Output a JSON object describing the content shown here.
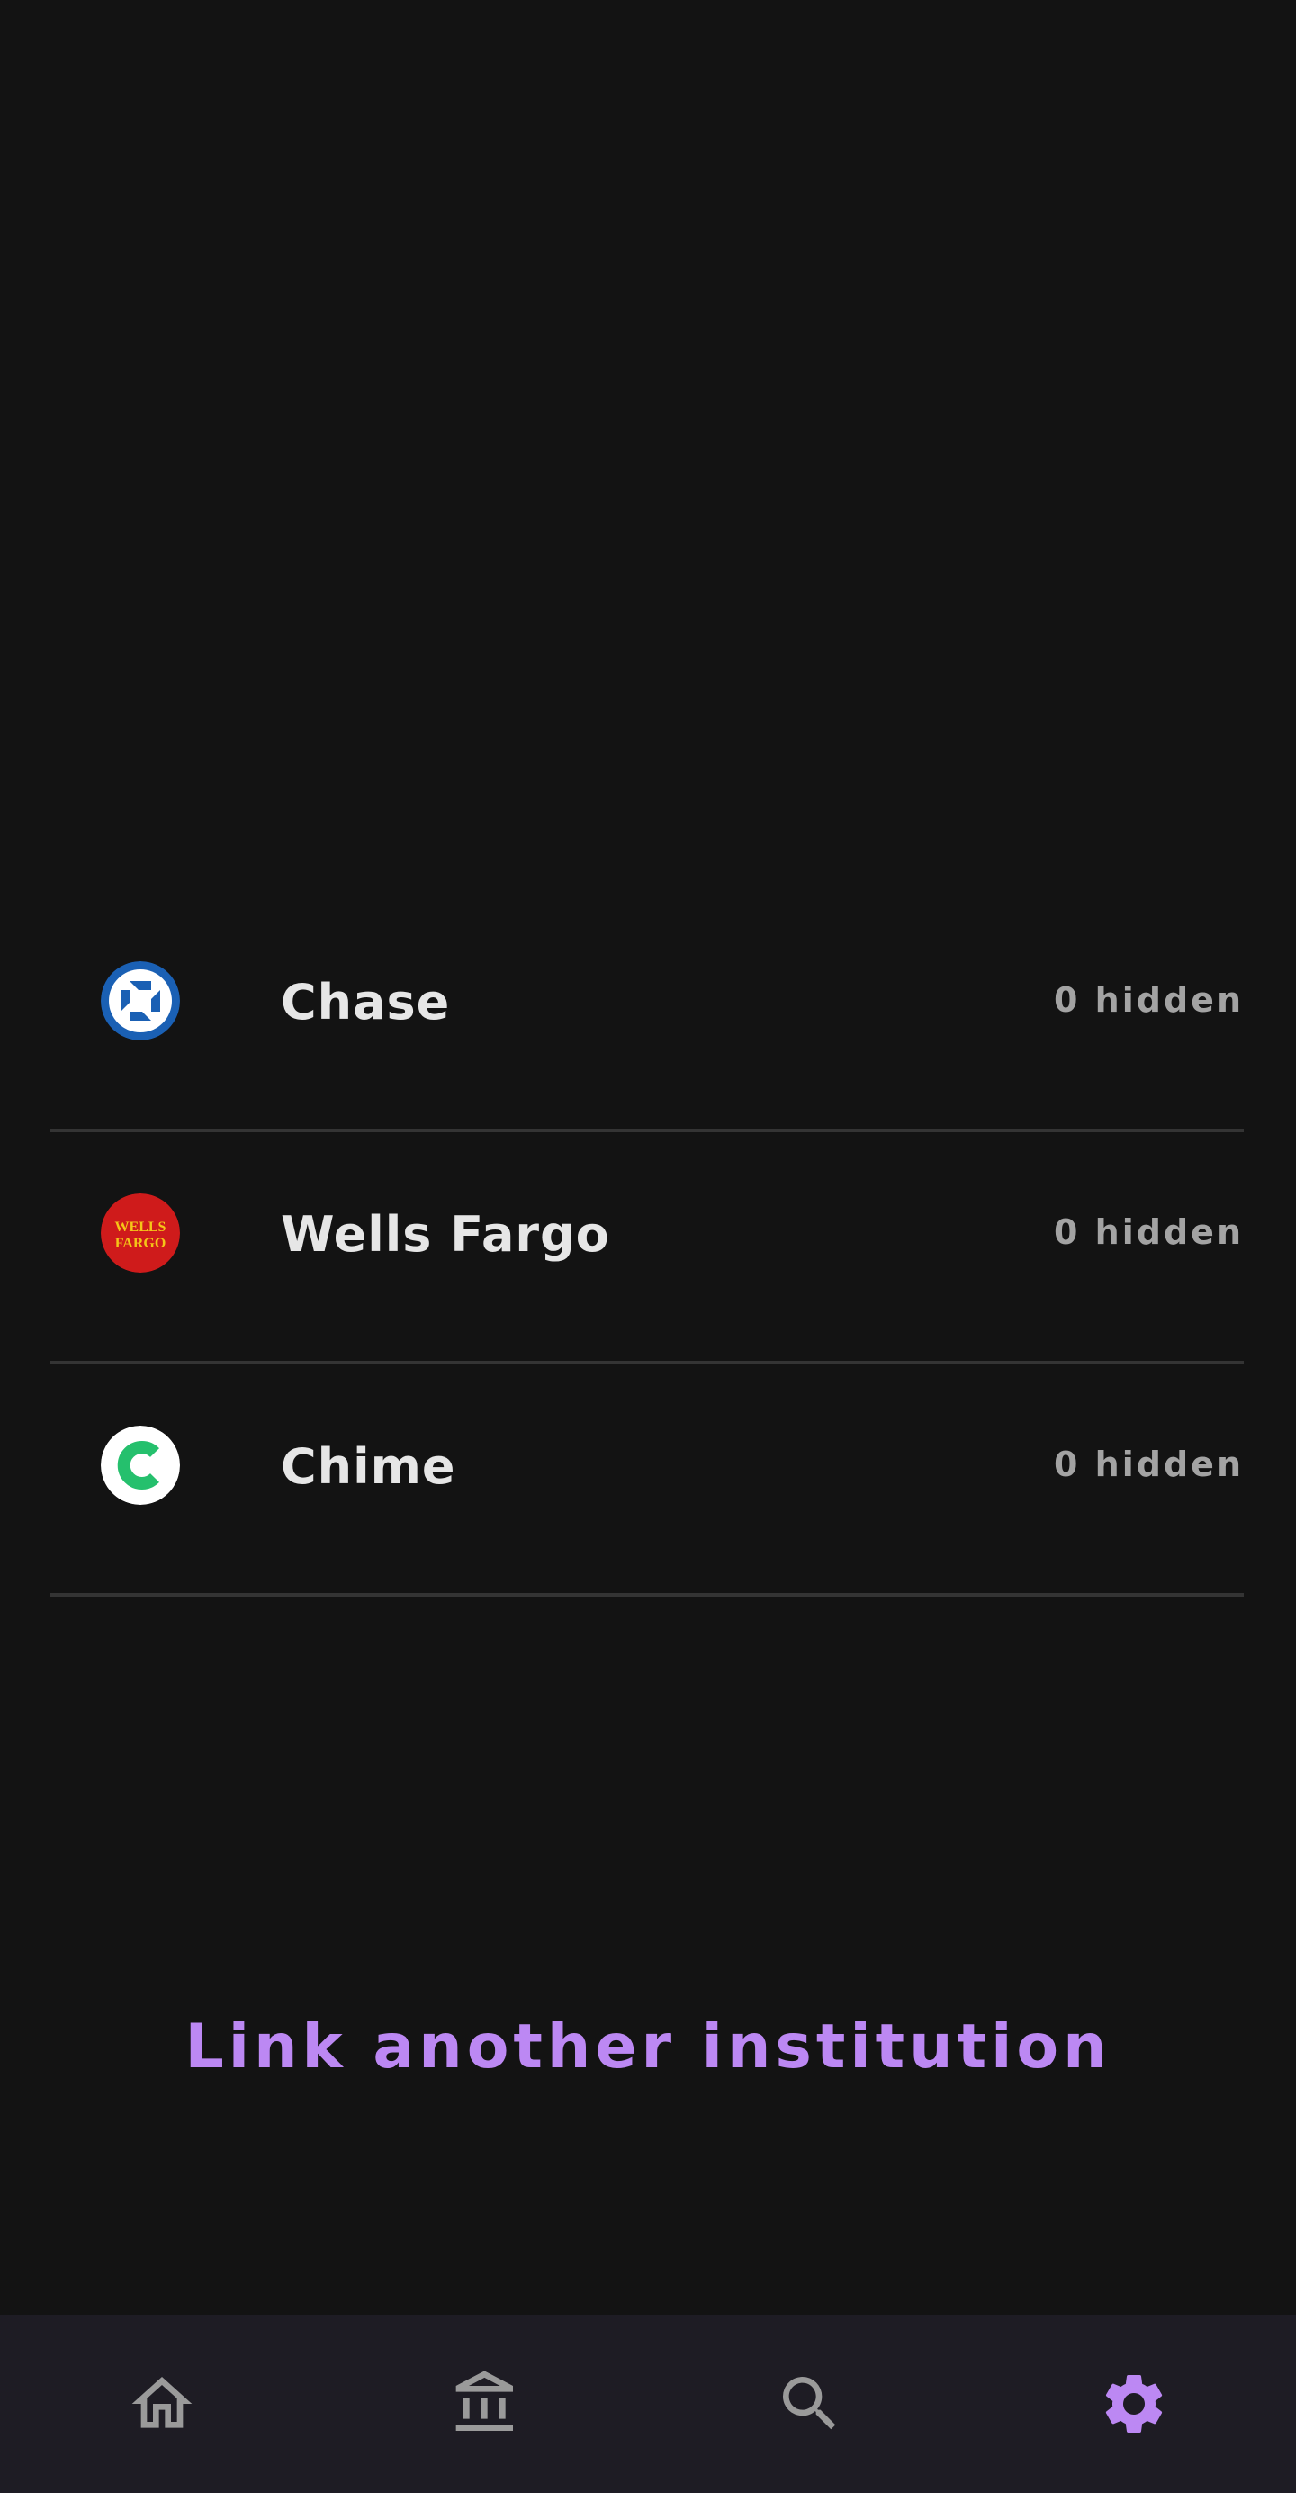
{
  "institutions": [
    {
      "name": "Chase",
      "hidden": "0 hidden",
      "logo_icon": "chase-logo-icon"
    },
    {
      "name": "Wells Fargo",
      "hidden": "0 hidden",
      "logo_icon": "wells-fargo-logo-icon",
      "logo_text": [
        "WELLS",
        "FARGO"
      ]
    },
    {
      "name": "Chime",
      "hidden": "0 hidden",
      "logo_icon": "chime-logo-icon"
    }
  ],
  "link_button": "Link another institution",
  "bottom_nav": {
    "items": [
      {
        "icon": "home-icon",
        "active": false
      },
      {
        "icon": "bank-icon",
        "active": false
      },
      {
        "icon": "search-icon",
        "active": false
      },
      {
        "icon": "settings-gear-icon",
        "active": true
      }
    ]
  },
  "colors": {
    "background": "#131313",
    "accent": "#bc88f3",
    "nav_background": "#1e1c24",
    "inactive_icon": "#9a9a9a",
    "divider": "#343434"
  }
}
